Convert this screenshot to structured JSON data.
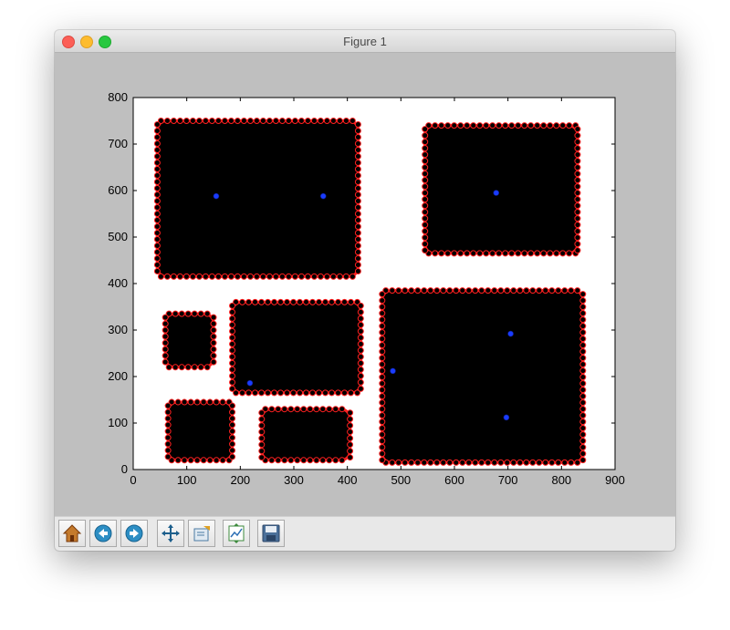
{
  "window": {
    "title": "Figure 1"
  },
  "toolbar": {
    "buttons": [
      {
        "name": "home-button",
        "icon": "home-icon"
      },
      {
        "name": "back-button",
        "icon": "back-arrow-icon"
      },
      {
        "name": "forward-button",
        "icon": "forward-arrow-icon"
      },
      {
        "name": "pan-button",
        "icon": "move-icon"
      },
      {
        "name": "zoom-button",
        "icon": "zoom-rect-icon"
      },
      {
        "name": "subplots-button",
        "icon": "subplots-icon"
      },
      {
        "name": "save-button",
        "icon": "save-icon"
      }
    ]
  },
  "colors": {
    "points": "#000000",
    "point_edge": "#ff2020",
    "centroids": "#1a3cff",
    "window_bg": "#bfbfbf"
  },
  "chart_data": {
    "type": "scatter",
    "title": "",
    "xlabel": "",
    "ylabel": "",
    "xlim": [
      0,
      900
    ],
    "ylim": [
      0,
      800
    ],
    "xticks": [
      "0",
      "100",
      "200",
      "300",
      "400",
      "500",
      "600",
      "700",
      "800",
      "900"
    ],
    "yticks": [
      "0",
      "100",
      "200",
      "300",
      "400",
      "500",
      "600",
      "700",
      "800"
    ],
    "grid": false,
    "clusters": [
      {
        "x": [
          45,
          420
        ],
        "y": [
          415,
          750
        ]
      },
      {
        "x": [
          545,
          830
        ],
        "y": [
          465,
          740
        ]
      },
      {
        "x": [
          60,
          150
        ],
        "y": [
          220,
          335
        ]
      },
      {
        "x": [
          185,
          425
        ],
        "y": [
          165,
          360
        ]
      },
      {
        "x": [
          65,
          185
        ],
        "y": [
          20,
          145
        ]
      },
      {
        "x": [
          240,
          405
        ],
        "y": [
          20,
          130
        ]
      },
      {
        "x": [
          465,
          840
        ],
        "y": [
          15,
          385
        ]
      }
    ],
    "centroids": [
      {
        "x": 155,
        "y": 588
      },
      {
        "x": 355,
        "y": 588
      },
      {
        "x": 678,
        "y": 595
      },
      {
        "x": 705,
        "y": 292
      },
      {
        "x": 485,
        "y": 212
      },
      {
        "x": 218,
        "y": 186
      },
      {
        "x": 697,
        "y": 112
      }
    ]
  }
}
